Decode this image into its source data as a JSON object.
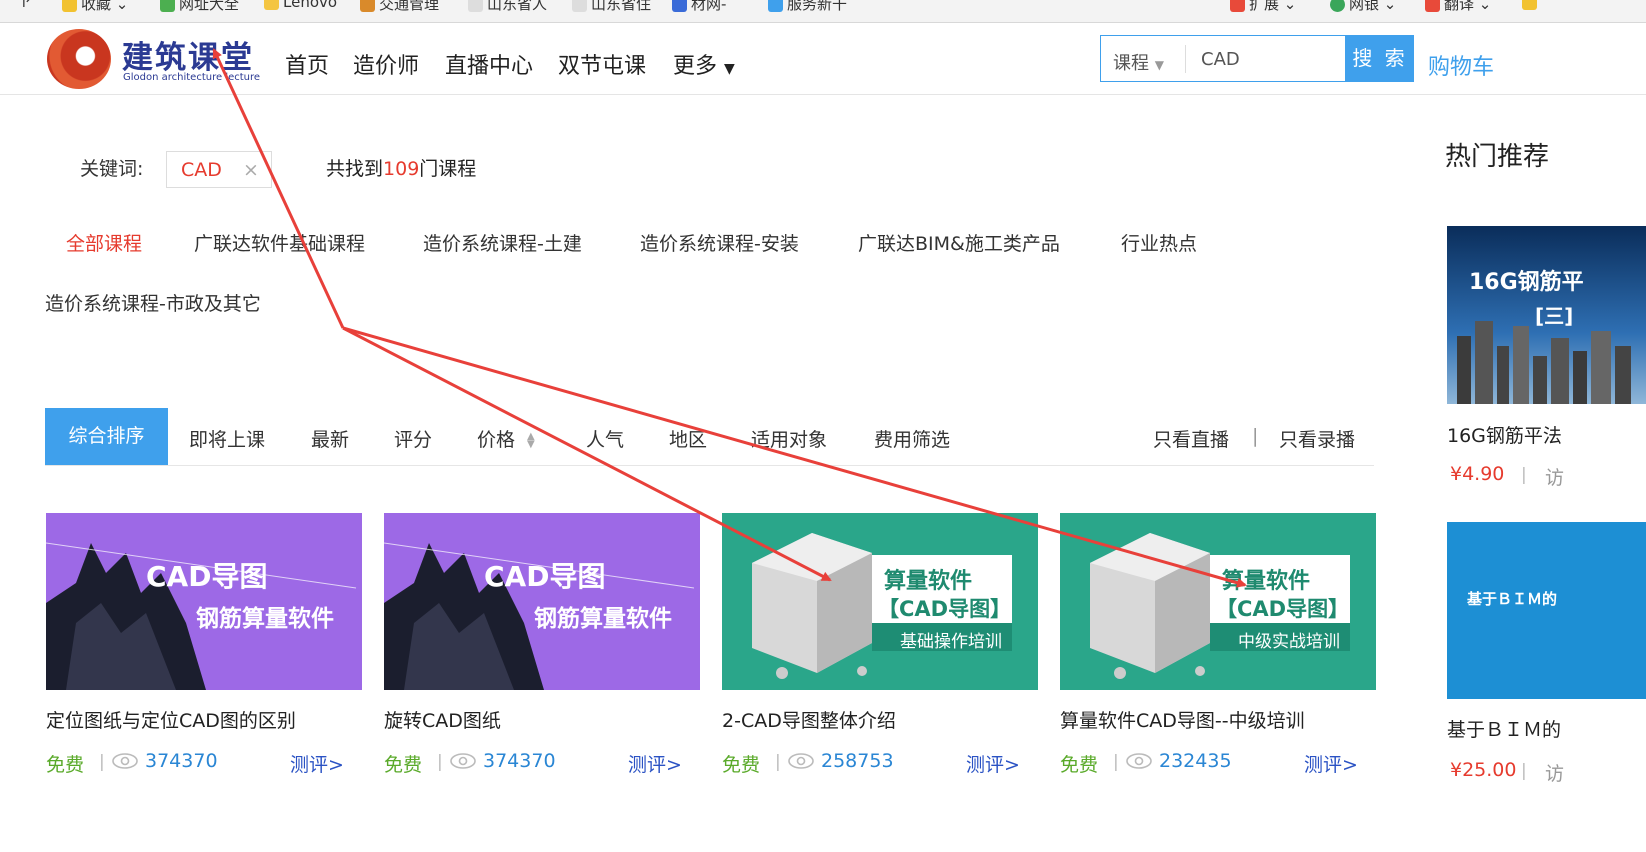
{
  "bookmarks": {
    "items": [
      "收藏",
      "网址大全",
      "Lenovo",
      "交通管理",
      "山东省人",
      "山东省住",
      "材网-",
      "服务新干"
    ],
    "right_items": [
      "扩展",
      "网银",
      "翻译"
    ]
  },
  "header": {
    "logo_title": "建筑课堂",
    "logo_subtitle": "Glodon architecture lecture",
    "nav": [
      "首页",
      "造价师",
      "直播中心",
      "双节屯课",
      "更多"
    ],
    "search": {
      "category": "课程",
      "value": "CAD",
      "button": "搜 索"
    },
    "cart": "购物车"
  },
  "filter": {
    "keyword_label": "关键词:",
    "keyword": "CAD",
    "found_prefix": "共找到",
    "found_count": "109",
    "found_suffix": "门课程",
    "categories": [
      "全部课程",
      "广联达软件基础课程",
      "造价系统课程-土建",
      "造价系统课程-安装",
      "广联达BIM&施工类产品",
      "行业热点",
      "造价系统课程-市政及其它"
    ]
  },
  "sort": {
    "options": [
      "综合排序",
      "即将上课",
      "最新",
      "评分",
      "价格",
      "人气",
      "地区",
      "适用对象",
      "费用筛选"
    ],
    "right": [
      "只看直播",
      "|",
      "只看录播"
    ]
  },
  "courses": [
    {
      "title": "定位图纸与定位CAD图的区别",
      "price": "免费",
      "views": "374370",
      "review": "测评>",
      "thumb_line1": "CAD导图",
      "thumb_line2": "钢筋算量软件"
    },
    {
      "title": "旋转CAD图纸",
      "price": "免费",
      "views": "374370",
      "review": "测评>",
      "thumb_line1": "CAD导图",
      "thumb_line2": "钢筋算量软件"
    },
    {
      "title": "2-CAD导图整体介绍",
      "price": "免费",
      "views": "258753",
      "review": "测评>",
      "thumb_line1": "算量软件",
      "thumb_line2": "【CAD导图】",
      "thumb_line3": "基础操作培训"
    },
    {
      "title": "算量软件CAD导图--中级培训",
      "price": "免费",
      "views": "232435",
      "review": "测评>",
      "thumb_line1": "算量软件",
      "thumb_line2": "【CAD导图】",
      "thumb_line3": "中级实战培训"
    }
  ],
  "sidebar": {
    "title": "热门推荐",
    "items": [
      {
        "title": "16G钢筋平法",
        "price": "¥4.90",
        "visits": "访",
        "thumb_text": "16G钢筋平",
        "thumb_text2": "[三]"
      },
      {
        "title": "基于ＢＩＭ的",
        "price": "¥25.00",
        "visits": "访",
        "thumb_text": "基于ＢＩＭ的"
      }
    ]
  },
  "colors": {
    "accent": "#3fa0ec",
    "red": "#e63b2e",
    "green": "#5aaa2a",
    "purple": "#9d69e6",
    "teal": "#2aa68a",
    "annotation": "#e8403a"
  }
}
